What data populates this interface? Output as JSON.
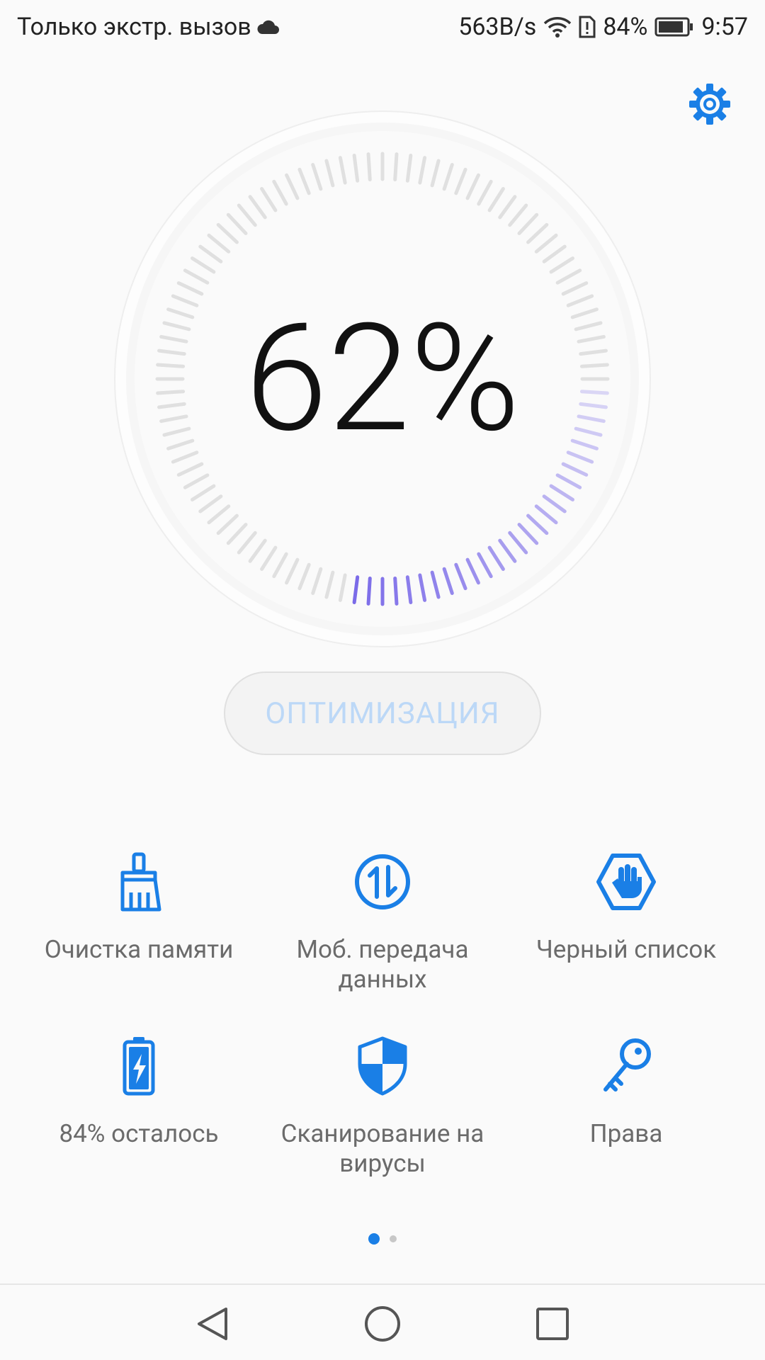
{
  "status_bar": {
    "carrier": "Только экстр. вызов",
    "speed": "563B/s",
    "battery": "84%",
    "time": "9:57"
  },
  "dial": {
    "percent": "62%",
    "progress": 0.62,
    "accent_color": "#7b6be8"
  },
  "optimize_button": {
    "label": "ОПТИМИЗАЦИЯ"
  },
  "tiles": [
    {
      "label": "Очистка памяти",
      "icon": "broom-icon"
    },
    {
      "label": "Моб. передача данных",
      "icon": "data-transfer-icon"
    },
    {
      "label": "Черный список",
      "icon": "block-hand-icon"
    },
    {
      "label": "84% осталось",
      "icon": "battery-icon"
    },
    {
      "label": "Сканирование на вирусы",
      "icon": "shield-icon"
    },
    {
      "label": "Права",
      "icon": "key-icon"
    }
  ],
  "pager": {
    "pages": 2,
    "current": 1
  },
  "colors": {
    "accent": "#1a7fe6",
    "dial_ticks": "#e0e0e0",
    "label": "#6b6b6b",
    "optimize_text": "#bcd8f7"
  }
}
